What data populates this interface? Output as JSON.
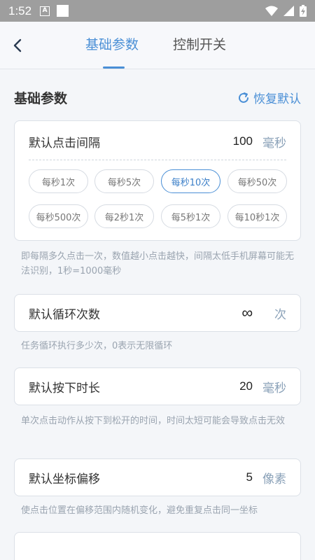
{
  "status": {
    "time": "1:52",
    "notif_glyph": "A"
  },
  "header": {
    "tabs": [
      {
        "label": "基础参数",
        "active": true
      },
      {
        "label": "控制开关",
        "active": false
      }
    ]
  },
  "section": {
    "title": "基础参数",
    "restore_label": "恢复默认"
  },
  "interval": {
    "label": "默认点击间隔",
    "value": "100",
    "unit": "毫秒",
    "presets": [
      "每秒1次",
      "每秒5次",
      "每秒10次",
      "每秒50次",
      "每秒500次",
      "每2秒1次",
      "每5秒1次",
      "每10秒1次"
    ],
    "selected_preset": "每秒10次",
    "desc": "即每隔多久点击一次，数值越小点击越快，间隔太低手机屏幕可能无法识别，1秒=1000毫秒"
  },
  "loop": {
    "label": "默认循环次数",
    "value": "∞",
    "unit": "次",
    "desc": "任务循环执行多少次，0表示无限循环"
  },
  "press": {
    "label": "默认按下时长",
    "value": "20",
    "unit": "毫秒",
    "desc": "单次点击动作从按下到松开的时间，时间太短可能会导致点击无效"
  },
  "offset": {
    "label": "默认坐标偏移",
    "value": "5",
    "unit": "像素",
    "desc": "使点击位置在偏移范围内随机变化，避免重复点击同一坐标"
  },
  "colors": {
    "accent": "#4a8fd6",
    "hint": "#9aa4b0"
  }
}
